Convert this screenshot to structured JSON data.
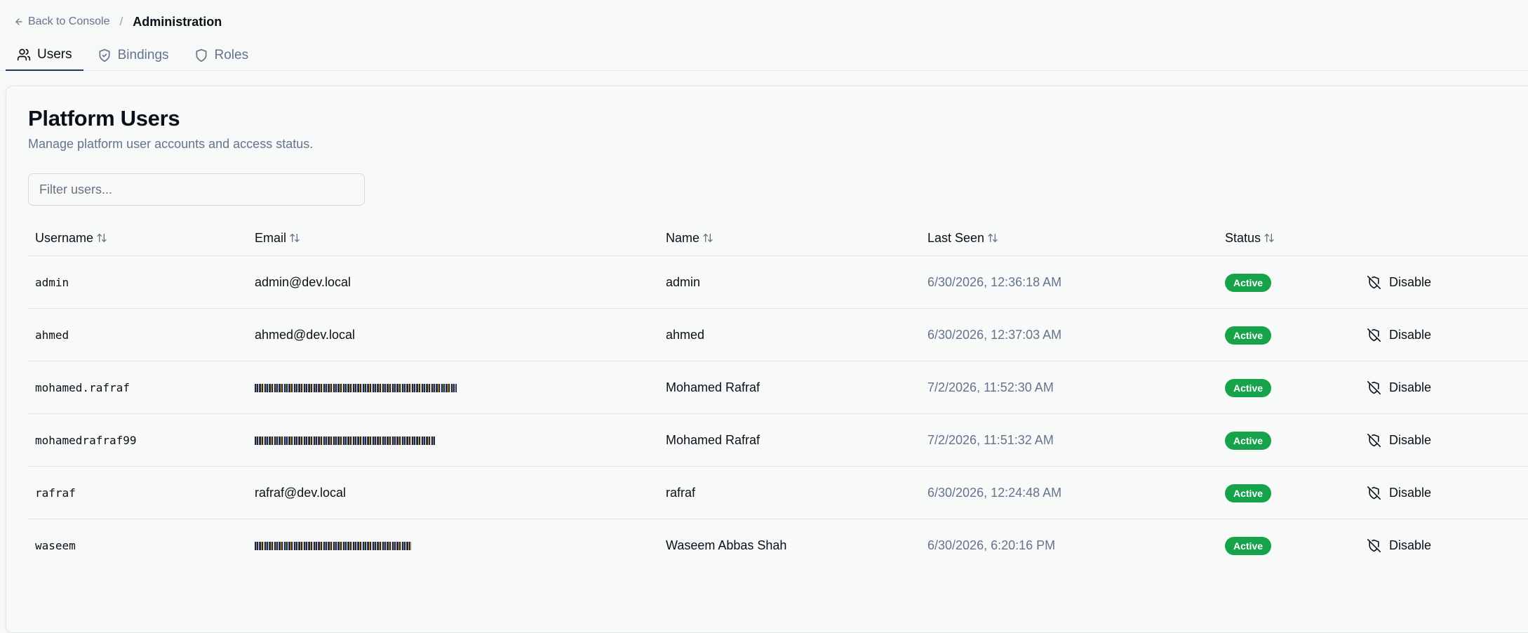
{
  "breadcrumb": {
    "back_label": "Back to Console",
    "separator": "/",
    "current": "Administration"
  },
  "tabs": [
    {
      "label": "Users",
      "icon": "users-icon",
      "active": true
    },
    {
      "label": "Bindings",
      "icon": "shield-check-icon",
      "active": false
    },
    {
      "label": "Roles",
      "icon": "shield-icon",
      "active": false
    }
  ],
  "page": {
    "title": "Platform Users",
    "subtitle": "Manage platform user accounts and access status.",
    "filter_placeholder": "Filter users..."
  },
  "table": {
    "columns": [
      "Username",
      "Email",
      "Name",
      "Last Seen",
      "Status"
    ],
    "action_label": "Disable",
    "rows": [
      {
        "username": "admin",
        "email": "admin@dev.local",
        "email_redacted": false,
        "name": "admin",
        "last_seen": "6/30/2026, 12:36:18 AM",
        "status": "Active"
      },
      {
        "username": "ahmed",
        "email": "ahmed@dev.local",
        "email_redacted": false,
        "name": "ahmed",
        "last_seen": "6/30/2026, 12:37:03 AM",
        "status": "Active"
      },
      {
        "username": "mohamed.rafraf",
        "email": "",
        "email_redacted": true,
        "name": "Mohamed Rafraf",
        "last_seen": "7/2/2026, 11:52:30 AM",
        "status": "Active"
      },
      {
        "username": "mohamedrafraf99",
        "email": "",
        "email_redacted": true,
        "name": "Mohamed Rafraf",
        "last_seen": "7/2/2026, 11:51:32 AM",
        "status": "Active"
      },
      {
        "username": "rafraf",
        "email": "rafraf@dev.local",
        "email_redacted": false,
        "name": "rafraf",
        "last_seen": "6/30/2026, 12:24:48 AM",
        "status": "Active"
      },
      {
        "username": "waseem",
        "email": "",
        "email_redacted": true,
        "name": "Waseem Abbas Shah",
        "last_seen": "6/30/2026, 6:20:16 PM",
        "status": "Active"
      }
    ]
  },
  "colors": {
    "active_badge": "#16a34a",
    "tab_underline": "#1f3b63",
    "muted_text": "#64748b"
  }
}
